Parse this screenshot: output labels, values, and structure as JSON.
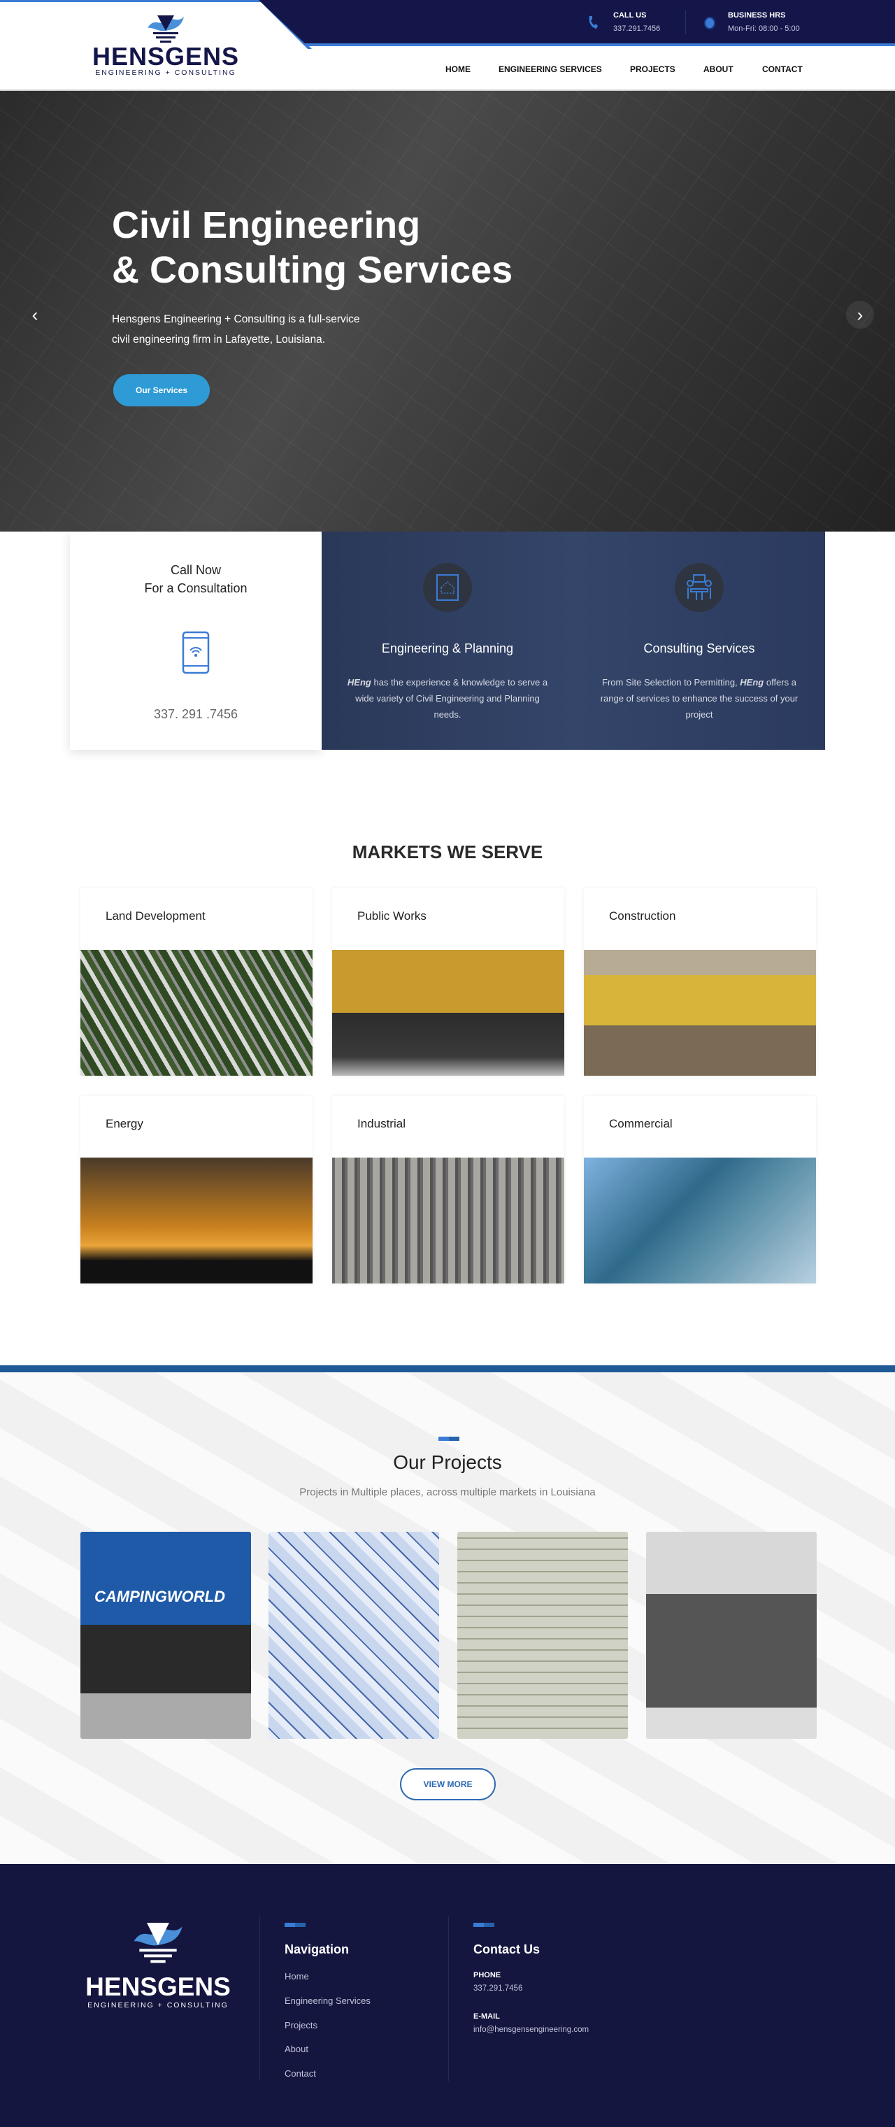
{
  "header": {
    "logo_name": "HENSGENS",
    "logo_tagline": "ENGINEERING + CONSULTING",
    "call_label": "CALL US",
    "call_value": "337.291.7456",
    "hours_label": "BUSINESS HRS",
    "hours_value": "Mon-Fri: 08:00 - 5:00",
    "nav": [
      "HOME",
      "ENGINEERING SERVICES",
      "PROJECTS",
      "ABOUT",
      "CONTACT"
    ]
  },
  "hero": {
    "title_line1": "Civil Engineering",
    "title_line2": "& Consulting Services",
    "text_line1": "Hensgens Engineering + Consulting is a full-service",
    "text_line2": "civil engineering firm in Lafayette, Louisiana.",
    "button": "Our Services"
  },
  "services": {
    "call_line1": "Call Now",
    "call_line2": "For a Consultation",
    "call_phone": "337. 291 .7456",
    "items": [
      {
        "title": "Engineering & Planning",
        "brand": "HEng",
        "text": " has the experience & knowledge to serve a wide variety of Civil Engineering and Planning needs."
      },
      {
        "title": "Consulting Services",
        "text_pre": "From Site Selection to Permitting, ",
        "brand": "HEng",
        "text": " offers a range of services to enhance the success of your project"
      }
    ]
  },
  "markets": {
    "title": "MARKETS WE SERVE",
    "items": [
      "Land Development",
      "Public Works",
      "Construction",
      "Energy",
      "Industrial",
      "Commercial"
    ]
  },
  "projects": {
    "title": "Our Projects",
    "subtitle": "Projects in Multiple places, across multiple markets in Louisiana",
    "image_sign": "CAMPINGWORLD",
    "button": "VIEW MORE"
  },
  "footer": {
    "logo_name": "HENSGENS",
    "logo_tagline": "ENGINEERING + CONSULTING",
    "nav_title": "Navigation",
    "nav": [
      "Home",
      "Engineering Services",
      "Projects",
      "About",
      "Contact"
    ],
    "contact_title": "Contact Us",
    "phone_label": "PHONE",
    "phone": "337.291.7456",
    "email_label": "E-MAIL",
    "email": "info@hensgensengineering.com"
  },
  "colors": {
    "navy": "#14164a",
    "accent": "#3a7bd5",
    "button": "#2e9bd6",
    "footer": "#14163f"
  }
}
